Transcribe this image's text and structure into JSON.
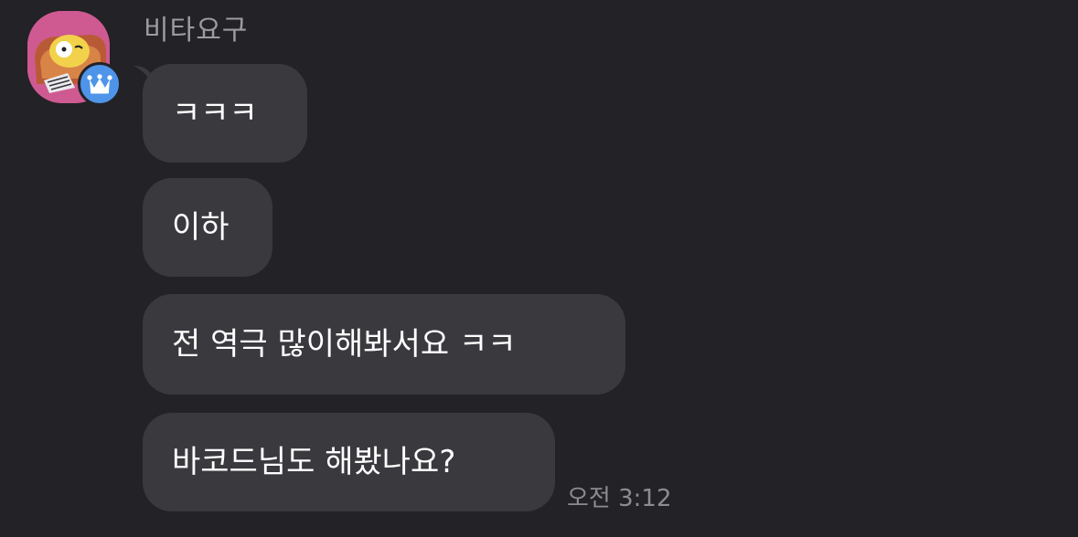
{
  "chat": {
    "sender": {
      "name": "비타요구",
      "role_badge": "crown-icon",
      "badge_color": "#4e95ea",
      "avatar_color": "#d55c95"
    },
    "messages": [
      {
        "text": "ㅋㅋㅋ"
      },
      {
        "text": "이하"
      },
      {
        "text": "전 역극 많이해봐서요 ㅋㅋ"
      },
      {
        "text": "바코드님도 해봤나요?"
      }
    ],
    "timestamp": "오전 3:12",
    "colors": {
      "background": "#232226",
      "bubble": "#3a393e",
      "text": "#ffffff",
      "meta": "#9c9ba0"
    }
  }
}
